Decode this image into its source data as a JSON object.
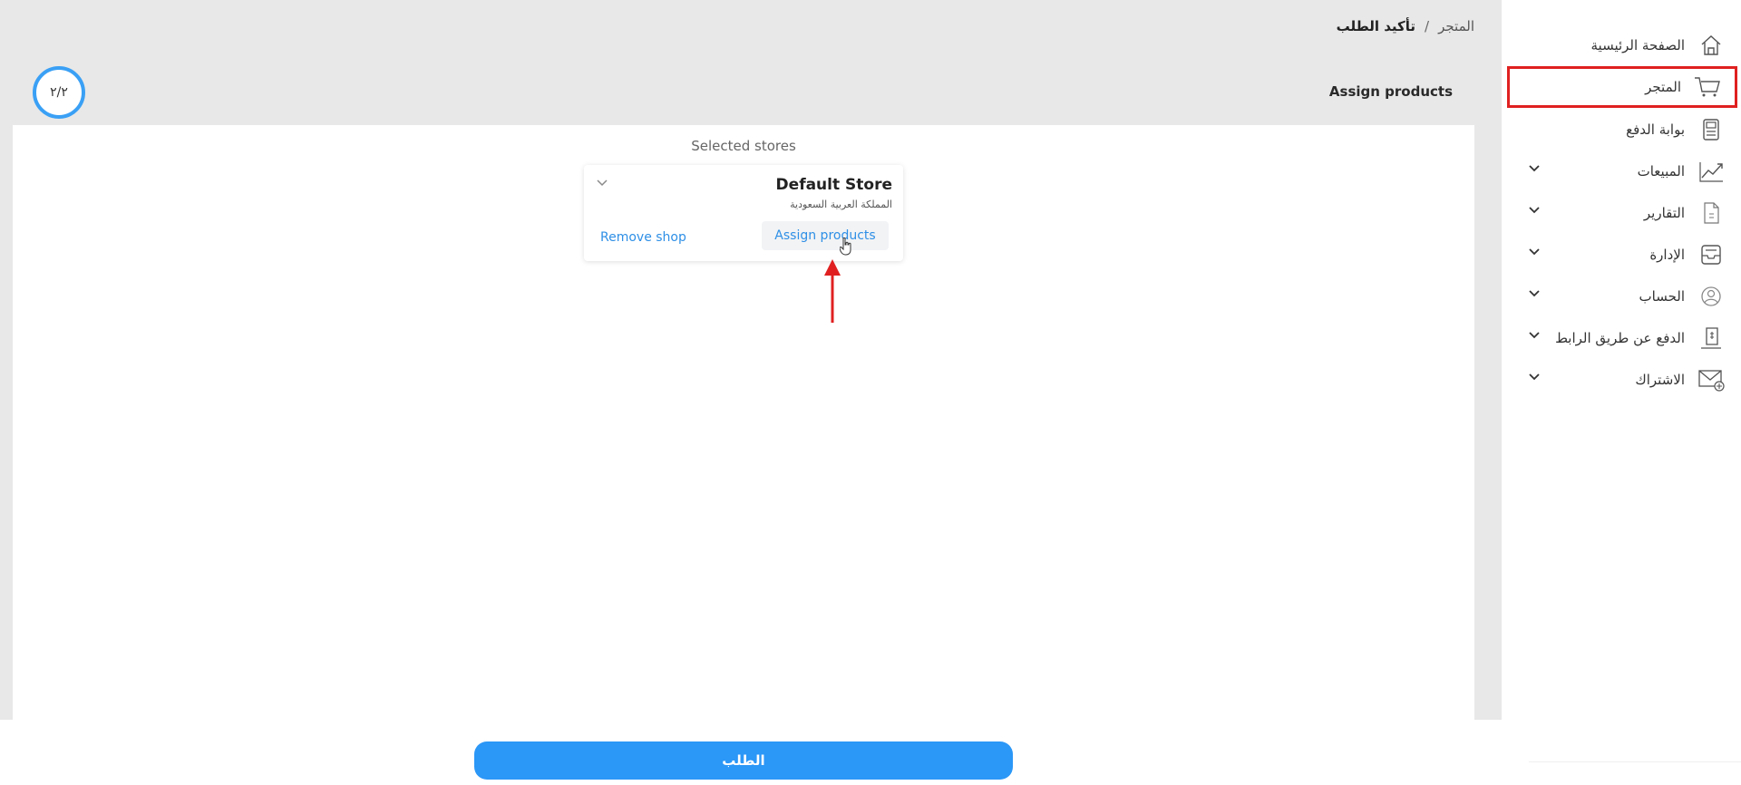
{
  "breadcrumb": {
    "parent": "المتجر",
    "separator": "/",
    "current": "تأكيد الطلب"
  },
  "step_indicator": "٢/٢",
  "section_title": "Assign products",
  "selected_stores": {
    "heading": "Selected stores",
    "store": {
      "name": "Default Store",
      "country": "المملكة العربية السعودية",
      "remove_label": "Remove shop",
      "assign_label": "Assign products"
    }
  },
  "order_button": "الطلب",
  "sidebar": {
    "items": [
      {
        "label": "الصفحة الرئيسية",
        "icon": "home-icon",
        "has_chevron": false
      },
      {
        "label": "المتجر",
        "icon": "cart-icon",
        "has_chevron": false,
        "active": true
      },
      {
        "label": "بوابة الدفع",
        "icon": "payment-terminal-icon",
        "has_chevron": false
      },
      {
        "label": "المبيعات",
        "icon": "chart-trend-icon",
        "has_chevron": true
      },
      {
        "label": "التقارير",
        "icon": "report-icon",
        "has_chevron": true
      },
      {
        "label": "الإدارة",
        "icon": "inbox-icon",
        "has_chevron": true
      },
      {
        "label": "الحساب",
        "icon": "user-circle-icon",
        "has_chevron": true
      },
      {
        "label": "الدفع عن طريق الرابط",
        "icon": "payment-link-icon",
        "has_chevron": true
      },
      {
        "label": "الاشتراك",
        "icon": "subscription-mail-icon",
        "has_chevron": true
      }
    ]
  },
  "colors": {
    "accent": "#2b97f7",
    "highlight": "#e02020",
    "background": "#e8e8e8"
  }
}
